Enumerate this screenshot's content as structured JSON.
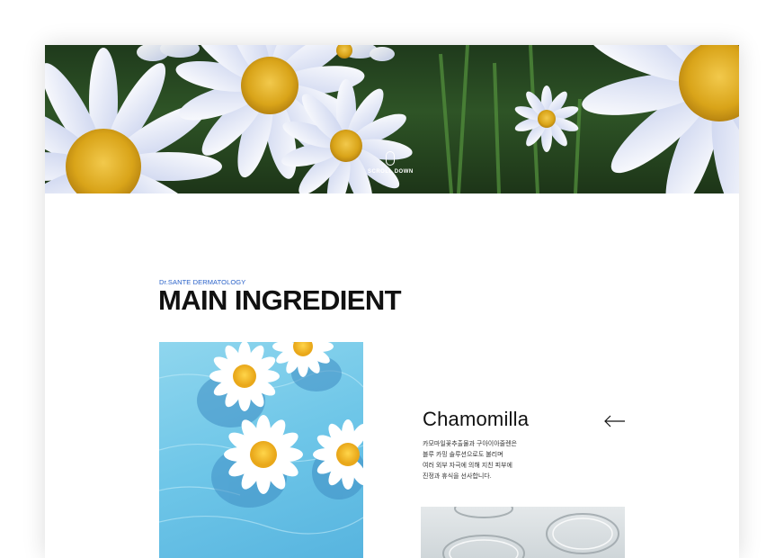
{
  "hero": {
    "scroll_label": "SCROLL DOWN",
    "image_subject": "daisy-field"
  },
  "section": {
    "brand": "Dr.SANTE DERMATOLOGY",
    "title": "MAIN INGREDIENT"
  },
  "ingredient": {
    "name": "Chamomilla",
    "description": [
      "카모마일꽃추출물과 구아이아줄렌은",
      "블루 카밍 솔루션으로도 불리며",
      "여러 외부 자극에 의해 지친 피부에",
      "진정과 휴식을 선사합니다."
    ],
    "prev_icon": "arrow-left-icon"
  },
  "colors": {
    "brand_blue": "#2a62c9",
    "title_black": "#111111"
  }
}
